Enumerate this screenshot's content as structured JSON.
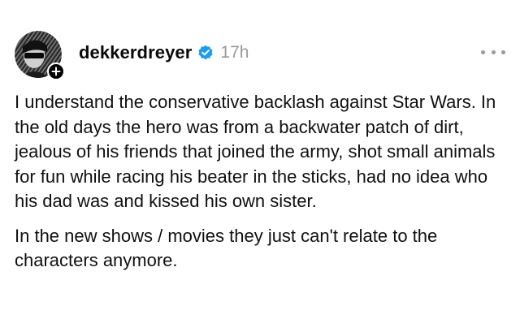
{
  "post": {
    "author": {
      "username": "dekkerdreyer",
      "avatar_icon": "avatar-sunglasses-portrait",
      "follow_icon": "plus-icon",
      "verified_icon": "verified-badge-icon"
    },
    "timestamp": "17h",
    "more_icon": "more-horizontal-icon",
    "paragraphs": [
      "I understand the conservative backlash against Star Wars. In the old days the hero was from a backwater patch of dirt, jealous of his friends that joined the army, shot small animals for fun while racing his beater in the sticks, had no idea who his dad was and kissed his own sister.",
      "In the new shows / movies they just can't relate to the characters anymore."
    ]
  },
  "colors": {
    "text": "#101010",
    "muted": "#9a9a9a",
    "verified_blue": "#1d9bf0",
    "badge": "#000000"
  }
}
